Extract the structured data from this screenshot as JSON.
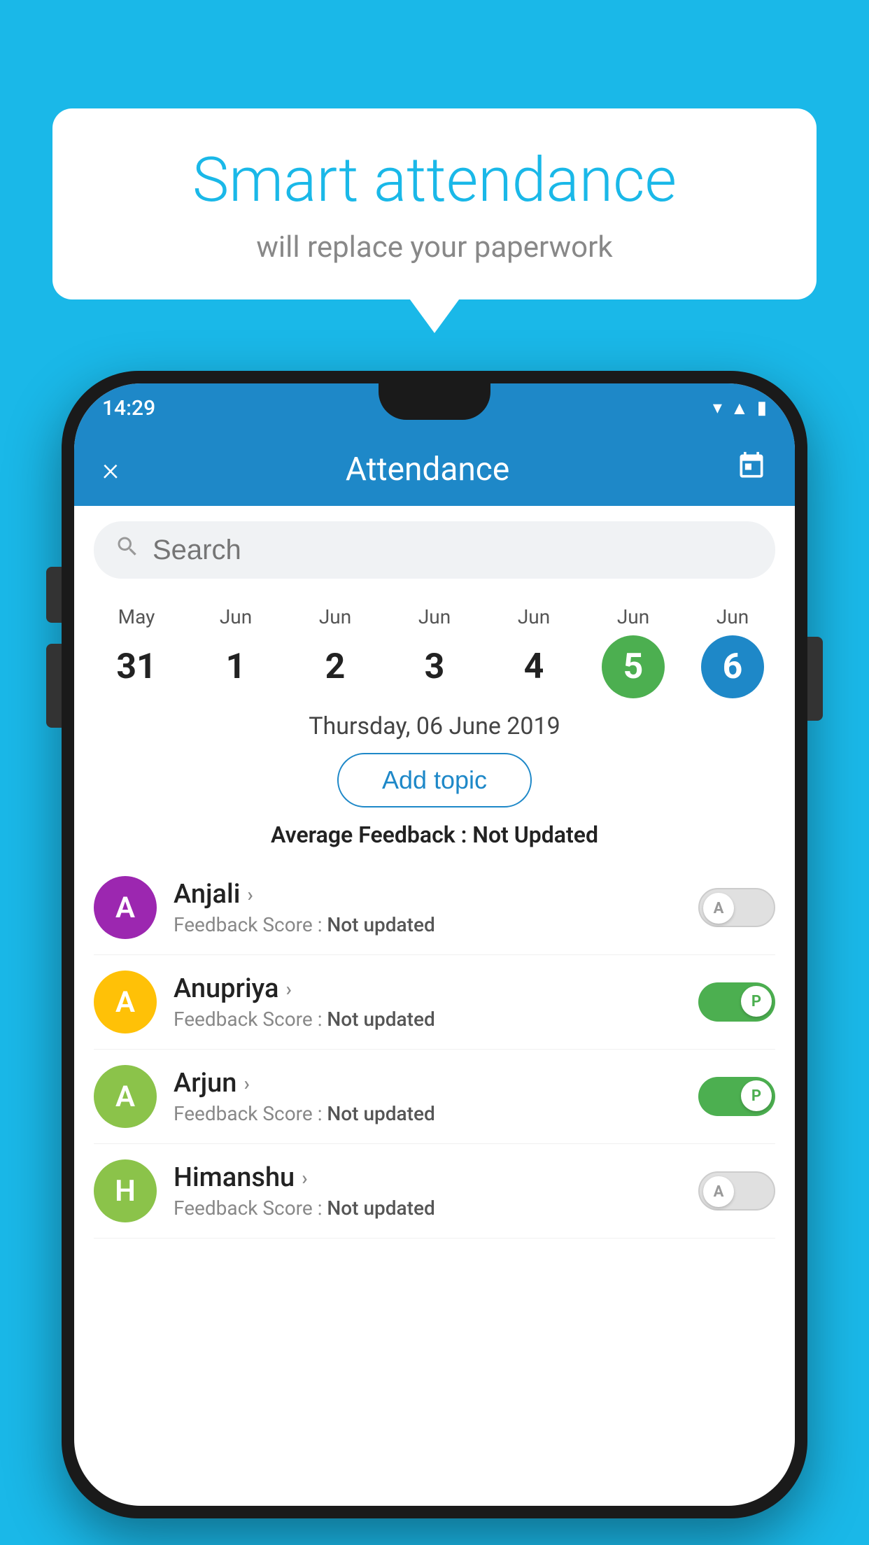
{
  "background_color": "#1ab8e8",
  "speech_bubble": {
    "title": "Smart attendance",
    "subtitle": "will replace your paperwork"
  },
  "phone": {
    "status_bar": {
      "time": "14:29"
    },
    "header": {
      "title": "Attendance",
      "close_label": "×",
      "calendar_label": "📅"
    },
    "search": {
      "placeholder": "Search"
    },
    "calendar": {
      "days": [
        {
          "month": "May",
          "date": "31",
          "state": "normal"
        },
        {
          "month": "Jun",
          "date": "1",
          "state": "normal"
        },
        {
          "month": "Jun",
          "date": "2",
          "state": "normal"
        },
        {
          "month": "Jun",
          "date": "3",
          "state": "normal"
        },
        {
          "month": "Jun",
          "date": "4",
          "state": "normal"
        },
        {
          "month": "Jun",
          "date": "5",
          "state": "today"
        },
        {
          "month": "Jun",
          "date": "6",
          "state": "selected"
        }
      ]
    },
    "selected_date": "Thursday, 06 June 2019",
    "add_topic_label": "Add topic",
    "average_feedback": {
      "label": "Average Feedback :",
      "value": "Not Updated"
    },
    "students": [
      {
        "name": "Anjali",
        "avatar_letter": "A",
        "avatar_color": "#9c27b0",
        "feedback_label": "Feedback Score :",
        "feedback_value": "Not updated",
        "attendance": "absent",
        "toggle_letter": "A"
      },
      {
        "name": "Anupriya",
        "avatar_letter": "A",
        "avatar_color": "#ffc107",
        "feedback_label": "Feedback Score :",
        "feedback_value": "Not updated",
        "attendance": "present",
        "toggle_letter": "P"
      },
      {
        "name": "Arjun",
        "avatar_letter": "A",
        "avatar_color": "#8bc34a",
        "feedback_label": "Feedback Score :",
        "feedback_value": "Not updated",
        "attendance": "present",
        "toggle_letter": "P"
      },
      {
        "name": "Himanshu",
        "avatar_letter": "H",
        "avatar_color": "#8bc34a",
        "feedback_label": "Feedback Score :",
        "feedback_value": "Not updated",
        "attendance": "absent",
        "toggle_letter": "A"
      }
    ]
  }
}
